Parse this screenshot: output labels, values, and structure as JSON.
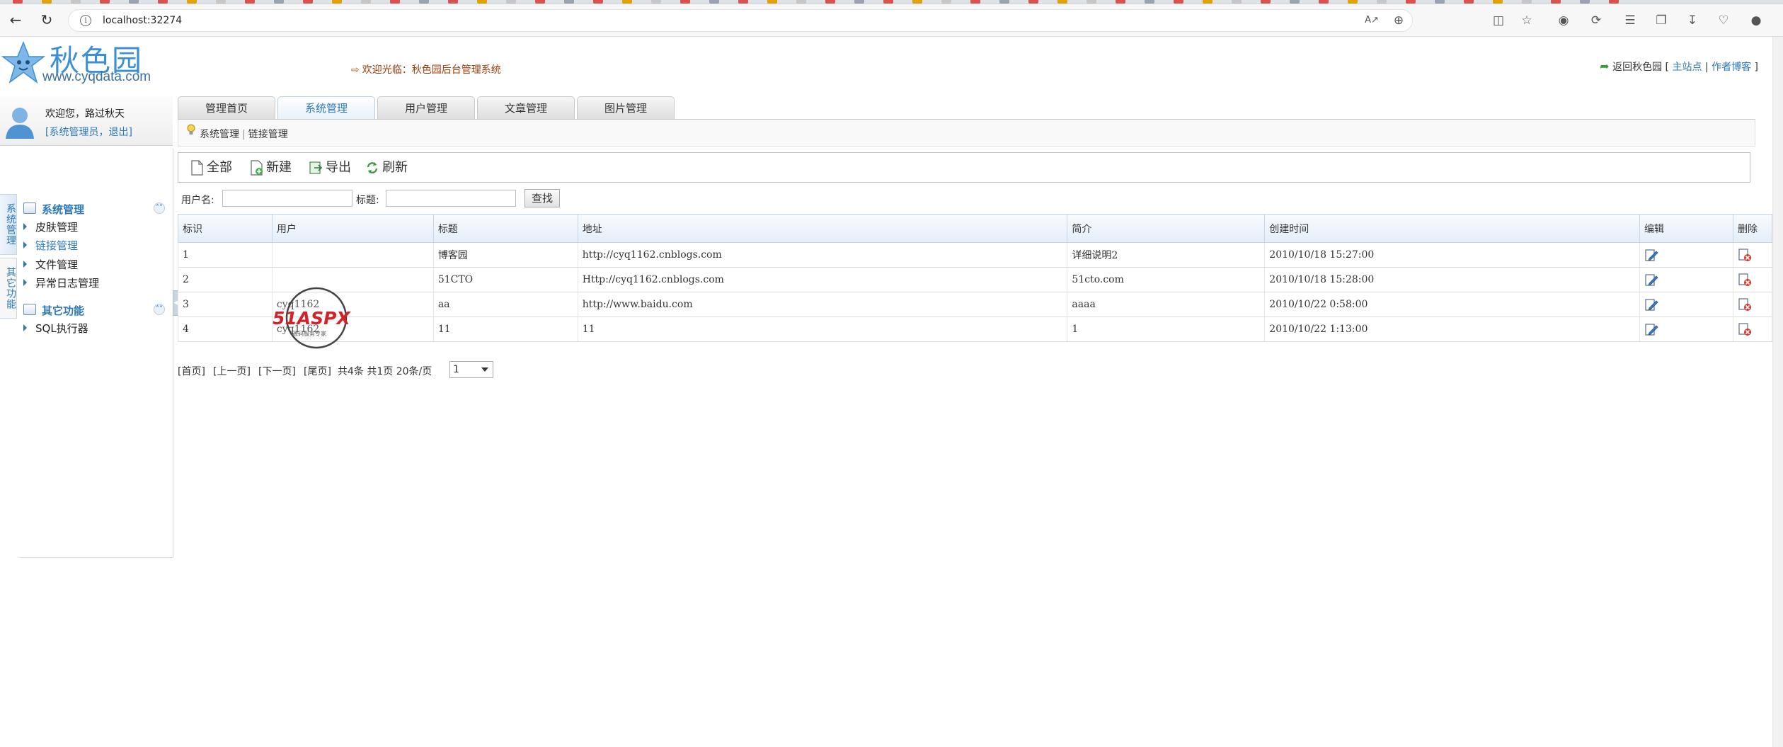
{
  "browser": {
    "url": "localhost:32274",
    "back_icon": "back-arrow-icon",
    "refresh_icon": "refresh-icon"
  },
  "header": {
    "logo_text": "秋色园",
    "logo_url": "www.cyqdata.com",
    "welcome": "欢迎光临：秋色园后台管理系统",
    "return_label": "返回秋色园",
    "bracket_open": "[",
    "bracket_close": "]",
    "main_site": "主站点",
    "link_sep": "|",
    "author_blog": "作者博客"
  },
  "user": {
    "greeting": "欢迎您，路过秋天",
    "role": "[系统管理员，",
    "logout": "退出]"
  },
  "vtabs": [
    "系统管理",
    "其它功能"
  ],
  "menu": {
    "sections": [
      {
        "title": "系统管理",
        "items": [
          "皮肤管理",
          "链接管理",
          "文件管理",
          "异常日志管理"
        ]
      },
      {
        "title": "其它功能",
        "items": [
          "SQL执行器"
        ]
      }
    ],
    "active_item": "链接管理"
  },
  "tabs": [
    "管理首页",
    "系统管理",
    "用户管理",
    "文章管理",
    "图片管理"
  ],
  "active_tab": "系统管理",
  "breadcrumb": [
    "系统管理",
    "链接管理"
  ],
  "toolbar": {
    "all": "全部",
    "new": "新建",
    "export": "导出",
    "refresh": "刷新"
  },
  "search": {
    "username_label": "用户名:",
    "username_value": "",
    "title_label": "标题:",
    "title_value": "",
    "button": "查找"
  },
  "table": {
    "headers": [
      "标识",
      "用户",
      "标题",
      "地址",
      "简介",
      "创建时间",
      "编辑",
      "删除"
    ],
    "rows": [
      {
        "id": "1",
        "user": "",
        "title": "博客园",
        "url": "http://cyq1162.cnblogs.com",
        "intro": "详细说明2",
        "created": "2010/10/18 15:27:00"
      },
      {
        "id": "2",
        "user": "",
        "title": "51CTO",
        "url": "Http://cyq1162.cnblogs.com",
        "intro": "51cto.com",
        "created": "2010/10/18 15:28:00"
      },
      {
        "id": "3",
        "user": "cyq1162",
        "title": "aa",
        "url": "http://www.baidu.com",
        "intro": "aaaa",
        "created": "2010/10/22 0:58:00"
      },
      {
        "id": "4",
        "user": "cyq1162",
        "title": "11",
        "url": "11",
        "intro": "1",
        "created": "2010/10/22 1:13:00"
      }
    ]
  },
  "watermark": {
    "text": "51ASPX",
    "subtitle": "源码服务专家"
  },
  "pager": {
    "first": "[首页]",
    "prev": "[上一页]",
    "next": "[下一页]",
    "last": "[尾页]",
    "summary": "共4条 共1页 20条/页",
    "current_page": "1"
  },
  "colors": {
    "accent": "#2d78b8",
    "header_text": "#9b3b0a"
  }
}
